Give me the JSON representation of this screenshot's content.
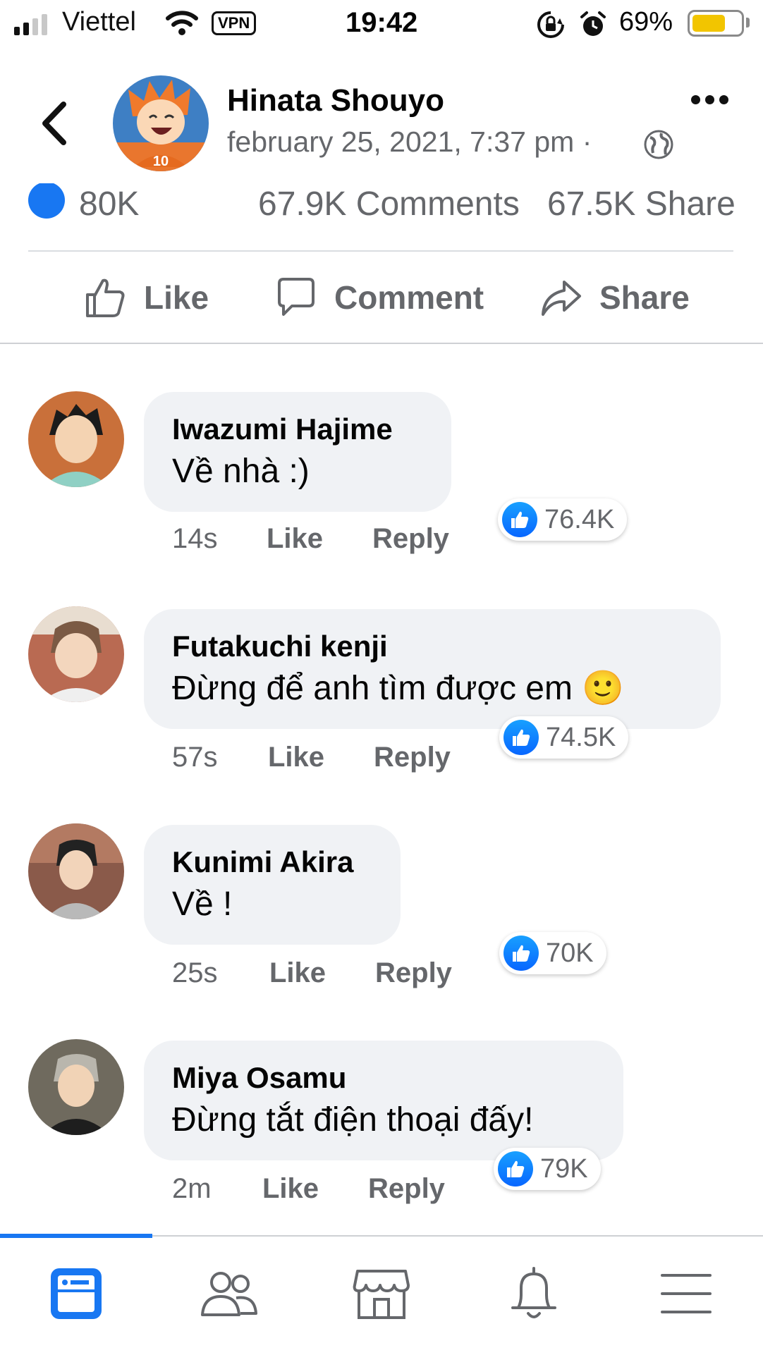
{
  "status_bar": {
    "carrier": "Viettel",
    "vpn": "VPN",
    "time": "19:42",
    "battery_percent": "69%",
    "battery_level": 0.69,
    "battery_color": "#f2c500",
    "icons": [
      "signal-icon",
      "wifi-icon",
      "rotation-lock-icon",
      "alarm-icon",
      "battery-icon"
    ]
  },
  "post": {
    "author": "Hinata Shouyo",
    "date": "february 25, 2021, 7:37 pm ·",
    "audience_icon": "globe-icon",
    "reactions": "80K",
    "comments": "67.9K Comments",
    "shares": "67.5K Share"
  },
  "actions": {
    "like": "Like",
    "comment": "Comment",
    "share": "Share"
  },
  "comments": [
    {
      "name": "Iwazumi Hajime",
      "text": "Về nhà :)",
      "time": "14s",
      "like": "Like",
      "reply": "Reply",
      "reactions": "76.4K"
    },
    {
      "name": "Futakuchi kenji",
      "text": "Đừng để anh tìm được em 🙂",
      "time": "57s",
      "like": "Like",
      "reply": "Reply",
      "reactions": "74.5K"
    },
    {
      "name": "Kunimi Akira",
      "text": "Về !",
      "time": "25s",
      "like": "Like",
      "reply": "Reply",
      "reactions": "70K"
    },
    {
      "name": "Miya Osamu",
      "text": "Đừng tắt điện thoại đấy!",
      "time": "2m",
      "like": "Like",
      "reply": "Reply",
      "reactions": "79K"
    }
  ],
  "tabbar": {
    "items": [
      "feed-icon",
      "friends-icon",
      "marketplace-icon",
      "notifications-icon",
      "menu-icon"
    ],
    "active": "feed-icon",
    "accent": "#1877f2"
  }
}
